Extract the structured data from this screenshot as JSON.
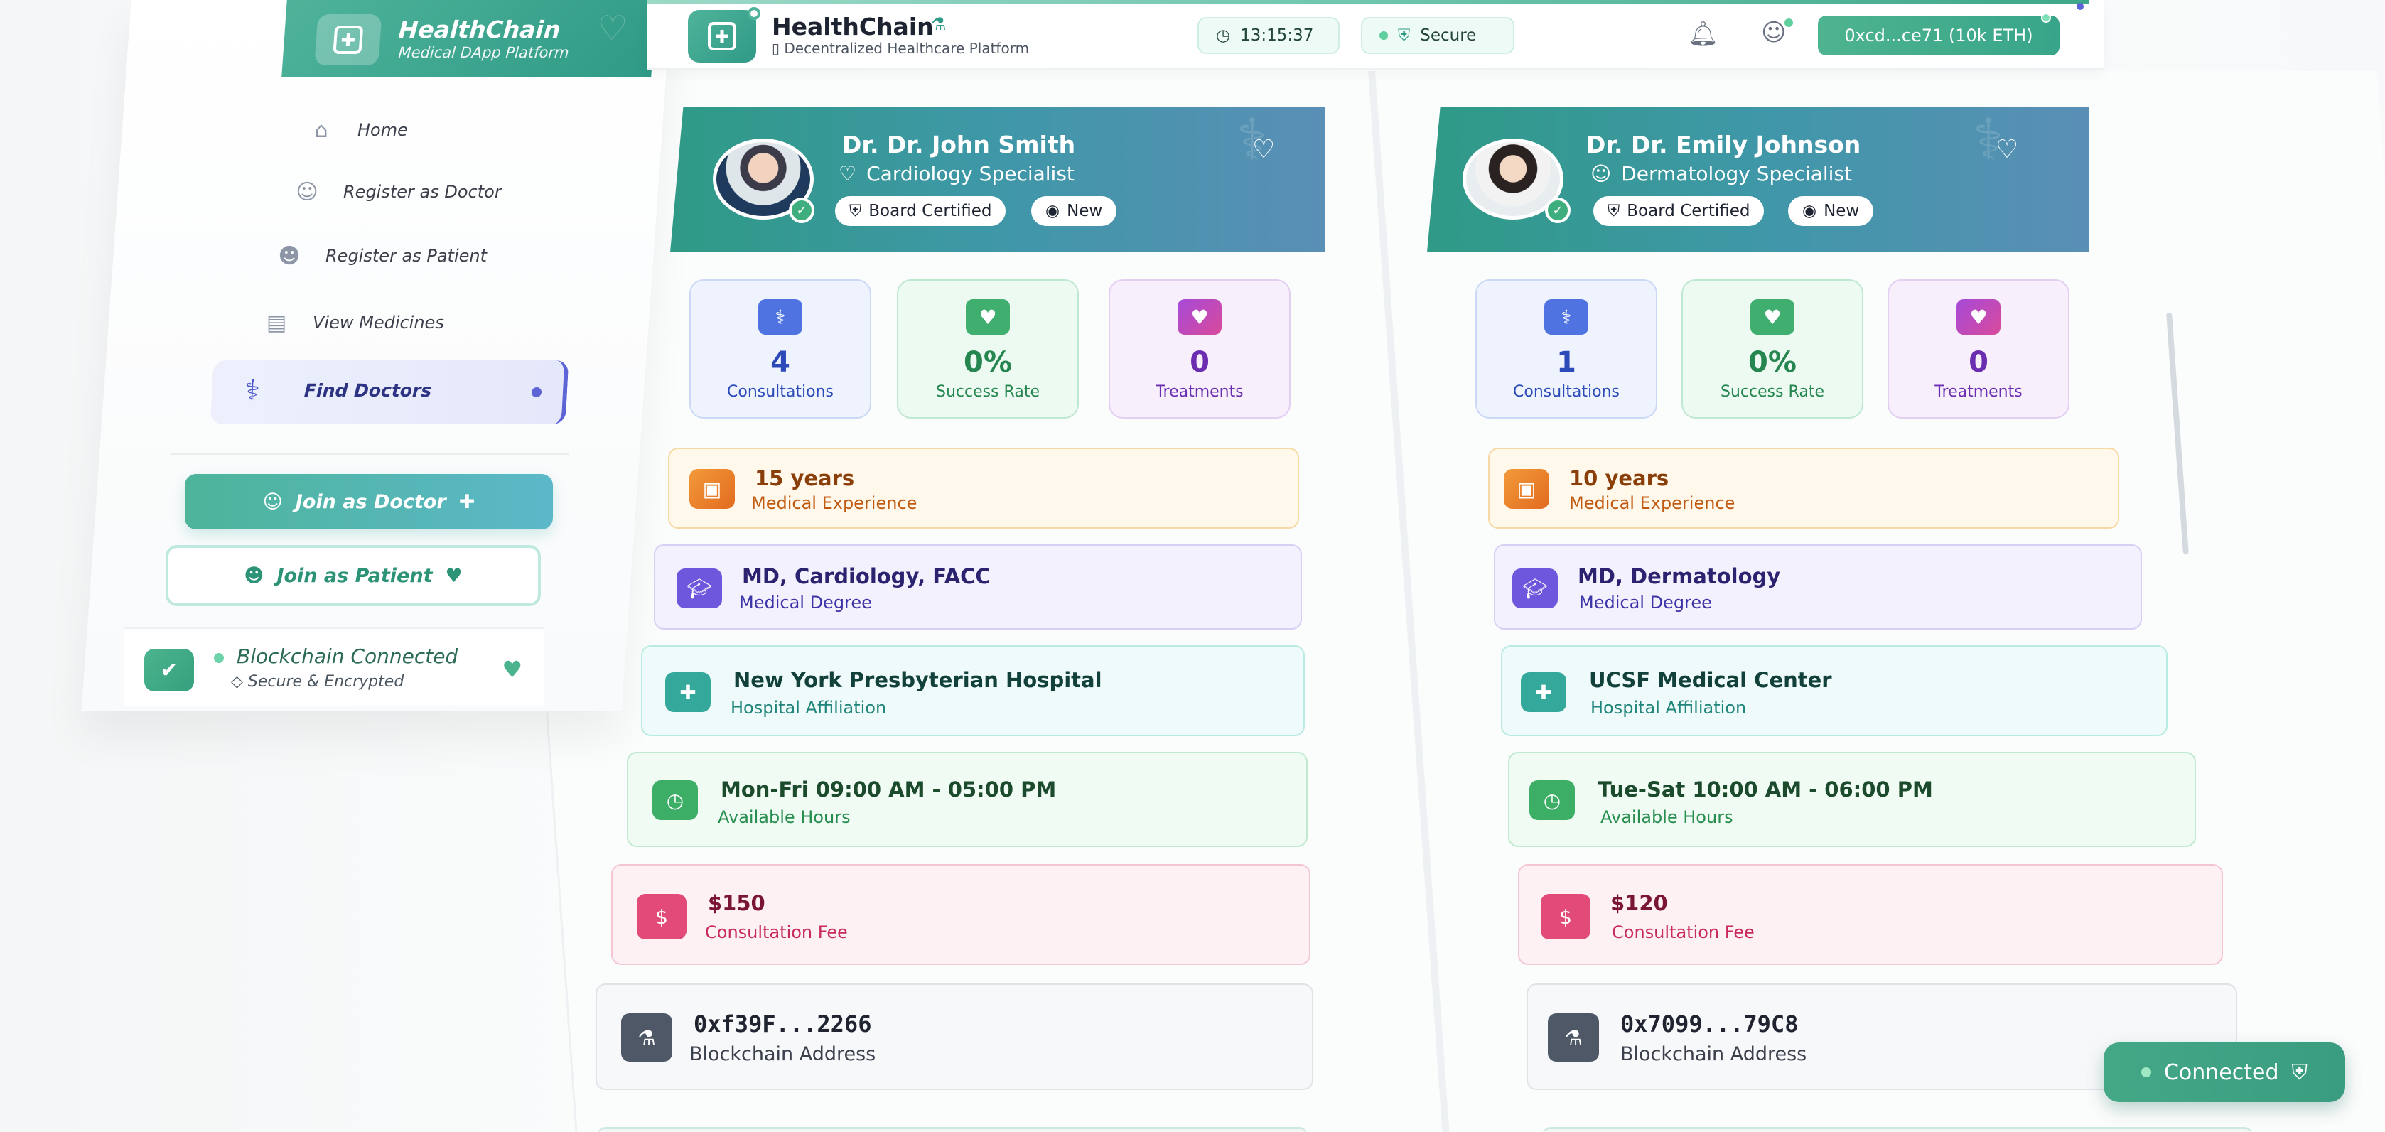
{
  "brand": {
    "name": "HealthChain",
    "subtitle": "Medical DApp Platform"
  },
  "header": {
    "title": "HealthChain",
    "subtitle": "Decentralized Healthcare Platform",
    "time": "13:15:37",
    "security": "Secure",
    "wallet": "0xcd...ce71 (10k ETH)"
  },
  "sidebar": {
    "items": [
      {
        "label": "Home",
        "icon": "home-icon"
      },
      {
        "label": "Register as Doctor",
        "icon": "user-doctor-icon"
      },
      {
        "label": "Register as Patient",
        "icon": "users-icon"
      },
      {
        "label": "View Medicines",
        "icon": "pill-bottle-icon"
      },
      {
        "label": "Find Doctors",
        "icon": "stethoscope-icon",
        "active": true
      }
    ],
    "join_doctor": "Join as Doctor",
    "join_patient": "Join as Patient",
    "chain_status": "Blockchain Connected",
    "chain_sub": "Secure & Encrypted"
  },
  "doctors": [
    {
      "name": "Dr. Dr. John Smith",
      "specialty": "Cardiology Specialist",
      "badges": [
        "Board Certified",
        "New"
      ],
      "stats": [
        {
          "value": "4",
          "label": "Consultations"
        },
        {
          "value": "0%",
          "label": "Success Rate"
        },
        {
          "value": "0",
          "label": "Treatments"
        }
      ],
      "experience": {
        "value": "15 years",
        "label": "Medical Experience"
      },
      "degree": {
        "value": "MD, Cardiology, FACC",
        "label": "Medical Degree"
      },
      "hospital": {
        "value": "New York Presbyterian Hospital",
        "label": "Hospital Affiliation"
      },
      "hours": {
        "value": "Mon-Fri 09:00 AM - 05:00 PM",
        "label": "Available Hours"
      },
      "fee": {
        "value": "$150",
        "label": "Consultation Fee"
      },
      "address": {
        "value": "0xf39F...2266",
        "label": "Blockchain Address"
      }
    },
    {
      "name": "Dr. Dr. Emily Johnson",
      "specialty": "Dermatology Specialist",
      "badges": [
        "Board Certified",
        "New"
      ],
      "stats": [
        {
          "value": "1",
          "label": "Consultations"
        },
        {
          "value": "0%",
          "label": "Success Rate"
        },
        {
          "value": "0",
          "label": "Treatments"
        }
      ],
      "experience": {
        "value": "10 years",
        "label": "Medical Experience"
      },
      "degree": {
        "value": "MD, Dermatology",
        "label": "Medical Degree"
      },
      "hospital": {
        "value": "UCSF Medical Center",
        "label": "Hospital Affiliation"
      },
      "hours": {
        "value": "Tue-Sat 10:00 AM - 06:00 PM",
        "label": "Available Hours"
      },
      "fee": {
        "value": "$120",
        "label": "Consultation Fee"
      },
      "address": {
        "value": "0x7099...79C8",
        "label": "Blockchain Address"
      }
    }
  ],
  "status": {
    "connected": "Connected"
  },
  "colors": {
    "accent": "#3fa88a",
    "active_nav": "#5c64d6"
  }
}
